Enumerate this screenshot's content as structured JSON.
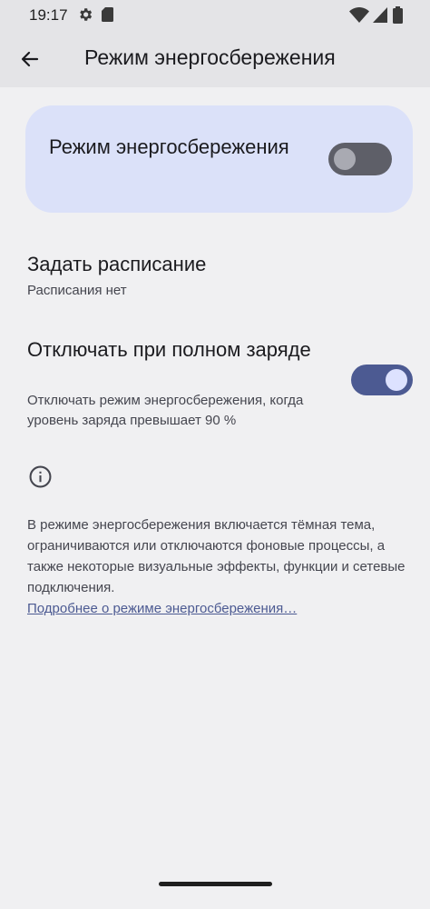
{
  "status_bar": {
    "time": "19:17",
    "icons": [
      "gear-icon",
      "sd-card-icon",
      "wifi-icon",
      "signal-icon",
      "battery-icon"
    ]
  },
  "app_bar": {
    "back_icon": "arrow-back-icon",
    "title": "Режим энергосбережения"
  },
  "main_toggle": {
    "label": "Режим энергосбережения",
    "enabled": false
  },
  "schedule": {
    "title": "Задать расписание",
    "subtitle": "Расписания нет"
  },
  "full_charge": {
    "title": "Отключать при полном заряде",
    "description": "Отключать режим энергосбережения, когда уровень заряда превышает 90 %",
    "enabled": true
  },
  "info": {
    "icon": "info-icon",
    "text": "В режиме энергосбережения включается тёмная тема, ограничиваются или отключаются фоновые процессы, а также некоторые визуальные эффекты, функции и сетевые подключения.",
    "link": "Подробнее о режиме энергосбережения…"
  },
  "colors": {
    "background": "#f0f0f2",
    "app_bar": "#e4e4e7",
    "card": "#dbe1f9",
    "accent": "#4c5a92",
    "switch_off_track": "#5e5f68"
  }
}
